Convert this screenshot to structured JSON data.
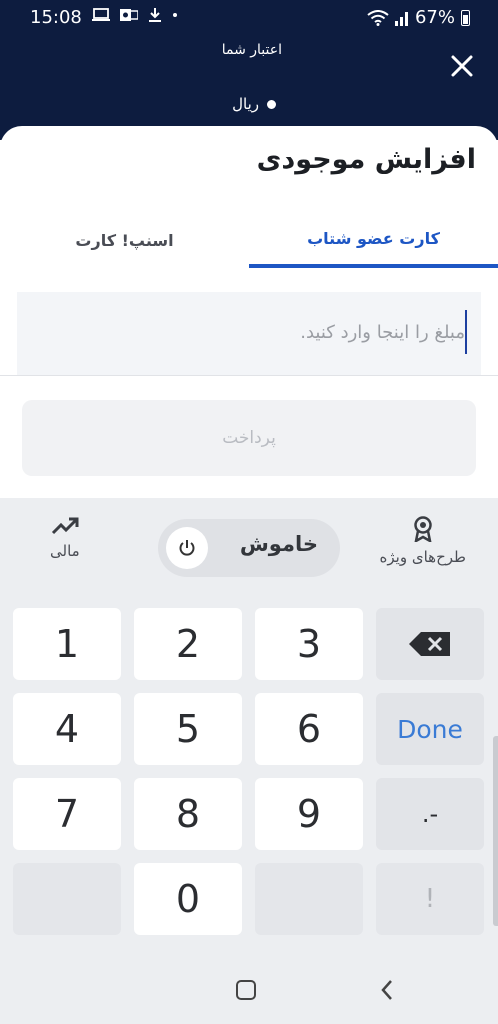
{
  "status_bar": {
    "time": "15:08",
    "battery": "67%",
    "left_icons": [
      "laptop-icon",
      "outlook-icon",
      "download-icon",
      "dot-icon"
    ],
    "right_icons": [
      "wifi-icon",
      "signal-icon",
      "battery-icon"
    ]
  },
  "header": {
    "credit_label": "اعتبار شما",
    "currency_label": "ریال",
    "close_icon": "close-icon"
  },
  "sheet": {
    "title": "افزایش موجودی",
    "tabs": [
      {
        "label": "کارت عضو شتاب",
        "active": true
      },
      {
        "label": "اسنپ! کارت",
        "active": false
      }
    ],
    "amount": {
      "placeholder": "مبلغ را اینجا وارد کنید.",
      "value": ""
    },
    "pay_button": "پرداخت"
  },
  "keyboard_toolbar": {
    "special_offers": "طرح‌های ویژه",
    "toggle_label": "خاموش",
    "finance": "مالی"
  },
  "keyboard": {
    "rows": [
      [
        "1",
        "2",
        "3",
        "⌫"
      ],
      [
        "4",
        "5",
        "6",
        "Done"
      ],
      [
        "7",
        "8",
        "9",
        ".-"
      ],
      [
        "",
        "0",
        "",
        "!"
      ]
    ]
  },
  "colors": {
    "header_bg": "#0d1c3f",
    "accent": "#1d56c4",
    "done": "#3a7bd5"
  }
}
